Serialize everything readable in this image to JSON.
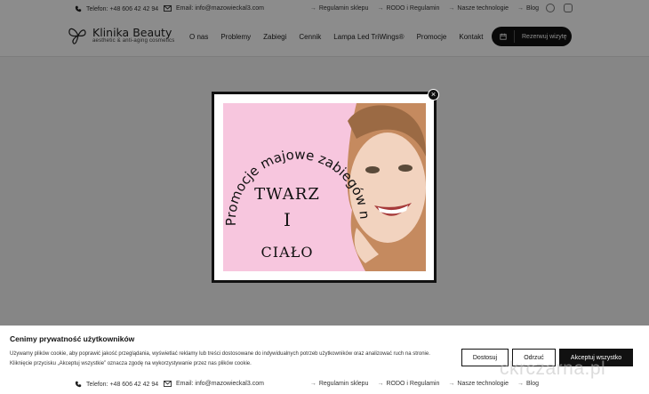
{
  "topbar": {
    "phone": "Telefon: +48 606 42 42 94",
    "email": "Email: info@mazowieckal3.com",
    "links": [
      "Regulamin sklepu",
      "RODO i Regulamin",
      "Nasze technologie",
      "Blog"
    ]
  },
  "nav": {
    "logo_name": "Klinika Beauty",
    "logo_sub": "aesthetic & anti-aging cosmetics",
    "items": [
      "O nas",
      "Problemy",
      "Zabiegi",
      "Cennik",
      "Lampa Led TriWings®",
      "Promocje",
      "Kontakt"
    ],
    "reserve": "Rezerwuj wizytę"
  },
  "promo": {
    "arc_text": "Promocje majowe zabiegów na",
    "line1": "TWARZ",
    "line2": "I",
    "line3": "CIAŁO"
  },
  "close_label": "×",
  "cookie": {
    "title": "Cenimy prywatność użytkowników",
    "text": "Używamy plików cookie, aby poprawić jakość przeglądania, wyświetlać reklamy lub treści dostosowane do indywidualnych potrzeb użytkowników oraz analizować ruch na stronie. Kliknięcie przycisku „Akceptuj wszystkie” oznacza zgodę na wykorzystywanie przez nas plików cookie.",
    "customize": "Dostosuj",
    "reject": "Odrzuć",
    "accept": "Akceptuj wszystko"
  },
  "bottombar": {
    "phone": "Telefon: +48 606 42 42 94",
    "email": "Email: info@mazowieckal3.com",
    "links": [
      "Regulamin sklepu",
      "RODO i Regulamin",
      "Nasze technologie",
      "Blog"
    ]
  },
  "watermark": "ckrczarna.pl",
  "colors": {
    "accent": "#111111",
    "promo_bg": "#f7c6de"
  }
}
